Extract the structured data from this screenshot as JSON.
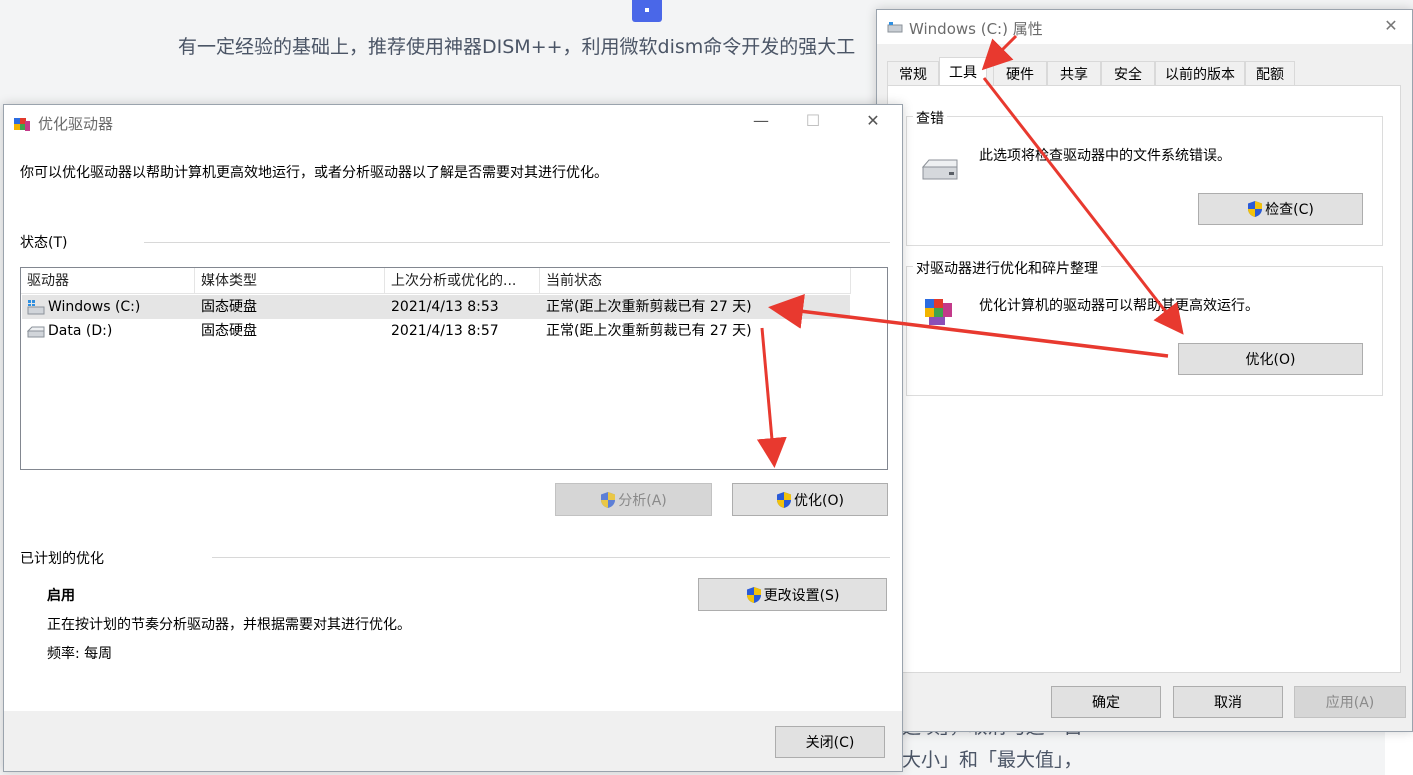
{
  "background": {
    "line1": "有一定经验的基础上，推荐使用神器DISM++，利用微软dism命令开发的强大工",
    "line2": "选项」，取消勾选「自",
    "line3": "大小」和「最大值」，"
  },
  "properties_window": {
    "title": "Windows (C:) 属性",
    "close_glyph": "✕",
    "tabs": [
      "常规",
      "工具",
      "硬件",
      "共享",
      "安全",
      "以前的版本",
      "配额"
    ],
    "active_tab": "工具",
    "check_group": {
      "title": "查错",
      "description": "此选项将检查驱动器中的文件系统错误。",
      "button": "检查(C)"
    },
    "optimize_group": {
      "title": "对驱动器进行优化和碎片整理",
      "description": "优化计算机的驱动器可以帮助其更高效运行。",
      "button": "优化(O)"
    },
    "footer": {
      "ok": "确定",
      "cancel": "取消",
      "apply": "应用(A)"
    }
  },
  "optimize_window": {
    "title": "优化驱动器",
    "controls": {
      "minimize": "—",
      "maximize": "☐",
      "close": "✕"
    },
    "intro": "你可以优化驱动器以帮助计算机更高效地运行，或者分析驱动器以了解是否需要对其进行优化。",
    "status_label": "状态(T)",
    "columns": [
      "驱动器",
      "媒体类型",
      "上次分析或优化的...",
      "当前状态"
    ],
    "drives": [
      {
        "name": "Windows (C:)",
        "media": "固态硬盘",
        "last": "2021/4/13 8:53",
        "status": "正常(距上次重新剪裁已有 27 天)",
        "icon": "windows-drive-icon"
      },
      {
        "name": "Data (D:)",
        "media": "固态硬盘",
        "last": "2021/4/13 8:57",
        "status": "正常(距上次重新剪裁已有 27 天)",
        "icon": "drive-icon"
      }
    ],
    "analyze_button": "分析(A)",
    "optimize_button": "优化(O)",
    "scheduled_label": "已计划的优化",
    "schedule_state": "启用",
    "schedule_desc": "正在按计划的节奏分析驱动器，并根据需要对其进行优化。",
    "frequency": "频率: 每周",
    "change_settings_button": "更改设置(S)",
    "close_button": "关闭(C)"
  },
  "accent_colors": {
    "arrow": "#e8392f",
    "shield_blue": "#2a5bd7",
    "shield_yellow": "#f2c20c"
  }
}
